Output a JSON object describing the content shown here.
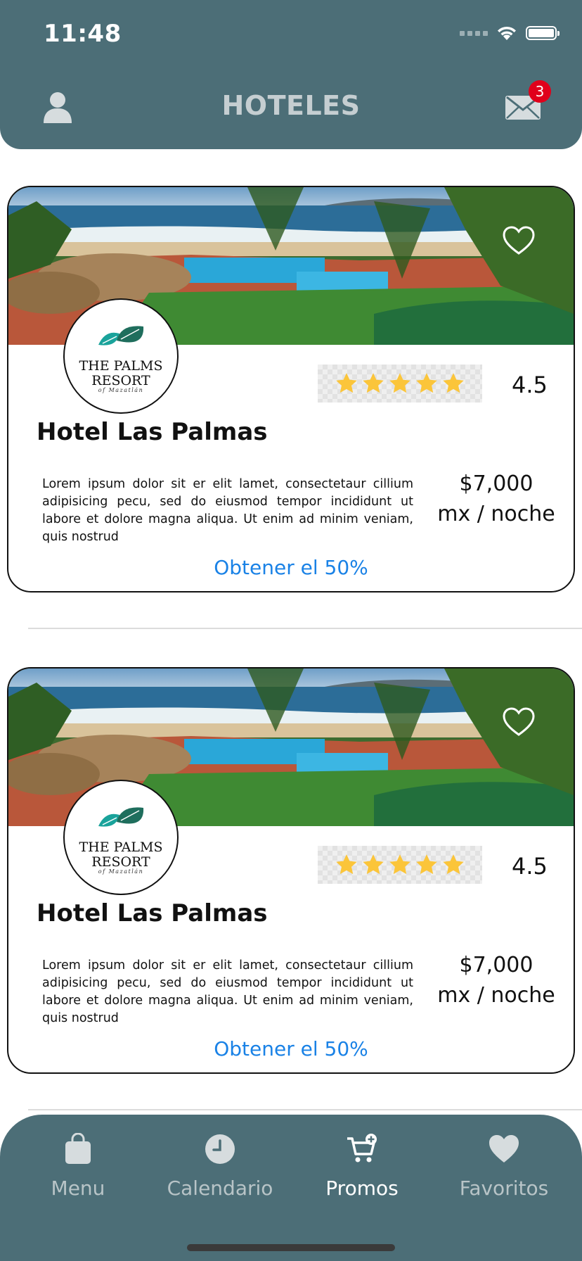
{
  "status_bar": {
    "time": "11:48"
  },
  "header": {
    "title": "HOTELES",
    "mail_badge": "3"
  },
  "cards": [
    {
      "logo_line1": "THE PALMS",
      "logo_line2": "RESORT",
      "logo_line3": "of Mazatlán",
      "rating_stars": 5,
      "rating": "4.5",
      "name": "Hotel Las Palmas",
      "description": "Lorem ipsum dolor sit er elit lamet, consectetaur cillium adipisicing pecu, sed do eiusmod tempor incididunt ut labore et dolore magna aliqua. Ut enim ad minim veniam, quis nostrud",
      "price": "$7,000",
      "price_unit": "mx / noche",
      "promo_label": "Obtener el 50%"
    },
    {
      "logo_line1": "THE PALMS",
      "logo_line2": "RESORT",
      "logo_line3": "of Mazatlán",
      "rating_stars": 5,
      "rating": "4.5",
      "name": "Hotel Las Palmas",
      "description": "Lorem ipsum dolor sit er elit lamet, consectetaur cillium adipisicing pecu, sed do eiusmod tempor incididunt ut labore et dolore magna aliqua. Ut enim ad minim veniam, quis nostrud",
      "price": "$7,000",
      "price_unit": "mx / noche",
      "promo_label": "Obtener el 50%"
    }
  ],
  "tabbar": {
    "items": [
      {
        "label": "Menu",
        "icon": "bag-icon"
      },
      {
        "label": "Calendario",
        "icon": "clock-icon"
      },
      {
        "label": "Promos",
        "icon": "cart-plus-icon",
        "active": true
      },
      {
        "label": "Favoritos",
        "icon": "heart-icon"
      }
    ]
  },
  "colors": {
    "header_bg": "#4c6e77",
    "link": "#1a82e6",
    "star": "#fbc53a",
    "badge": "#e0001b"
  }
}
